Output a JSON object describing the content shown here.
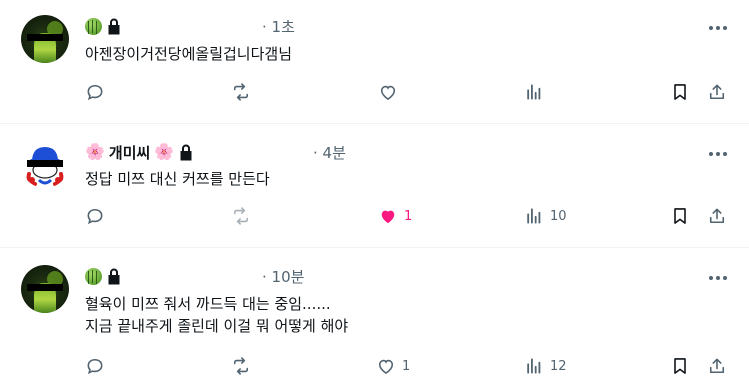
{
  "tweets": [
    {
      "time": "· 1초",
      "text": "아젠장이거전당에올릴겁니다갬님",
      "reply_count": "",
      "retweet_count": "",
      "like_count": "",
      "view_count": "",
      "liked": false
    },
    {
      "name": "개미씨",
      "name_prefix_emoji": "🌸",
      "name_suffix_emoji": "🌸",
      "time": "· 4분",
      "text": "정답 미쯔 대신 커쯔를 만든다",
      "reply_count": "",
      "retweet_count": "",
      "like_count": "1",
      "view_count": "10",
      "liked": true
    },
    {
      "time": "· 10분",
      "text": "혈육이 미쯔 줘서 까드득 대는 중임......\n지금 끝내주게 졸린데 이걸 뭐 어떻게 해야",
      "reply_count": "",
      "retweet_count": "",
      "like_count": "1",
      "view_count": "12",
      "liked": false
    }
  ],
  "colors": {
    "text": "#0f1419",
    "muted": "#536471",
    "like_active": "#f91880",
    "divider": "#eff3f4"
  },
  "icons": [
    "melon-badge-icon",
    "flower-icon",
    "lock-icon",
    "more-icon",
    "reply-icon",
    "retweet-icon",
    "like-icon",
    "views-icon",
    "bookmark-icon",
    "share-icon"
  ]
}
